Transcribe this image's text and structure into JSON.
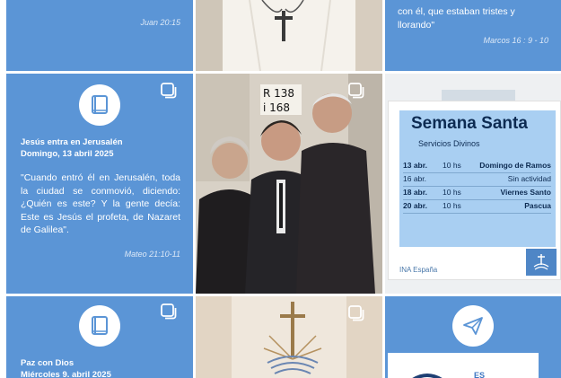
{
  "tiles": {
    "top_left": {
      "citation": "Juan 20:15"
    },
    "top_right": {
      "quote_end": "con él, que estaban tristes y llorando\"",
      "citation": "Marcos 16 : 9 - 10"
    },
    "mid_left": {
      "title_line1": "Jesús entra en Jerusalén",
      "title_line2": "Domingo, 13 abril 2025",
      "quote": "\"Cuando entró él en Jerusalén, toda la ciudad se conmovió, diciendo: ¿Quién es este? Y la gente decía: Este es Jesús el profeta, de Nazaret de Galilea\".",
      "citation": "Mateo 21:10-11"
    },
    "mid_center": {
      "sign_line1": "R 138",
      "sign_line2": "i 168"
    },
    "mid_right": {
      "title": "Semana Santa",
      "subtitle": "Servicios Divinos",
      "schedule": [
        {
          "date": "13 abr.",
          "time": "10 hs",
          "event": "Domingo de Ramos",
          "emph": true
        },
        {
          "date": "16 abr.",
          "time": "",
          "event": "Sin actividad",
          "emph": false
        },
        {
          "date": "18 abr.",
          "time": "10 hs",
          "event": "Viernes Santo",
          "emph": true
        },
        {
          "date": "20 abr.",
          "time": "10 hs",
          "event": "Pascua",
          "emph": true
        }
      ],
      "footer": "INA España"
    },
    "bottom_left": {
      "title_line1": "Paz con Dios",
      "title_line2": "Miércoles 9. abril 2025"
    },
    "bottom_right": {
      "partial_text": "ES"
    }
  },
  "colors": {
    "tile_blue": "#5b95d6",
    "flyer_blue": "#a9cff2",
    "flyer_text": "#0d2b52"
  },
  "icons": [
    "book-icon",
    "multiple-posts-icon",
    "paper-plane-icon",
    "church-emblem-icon"
  ]
}
